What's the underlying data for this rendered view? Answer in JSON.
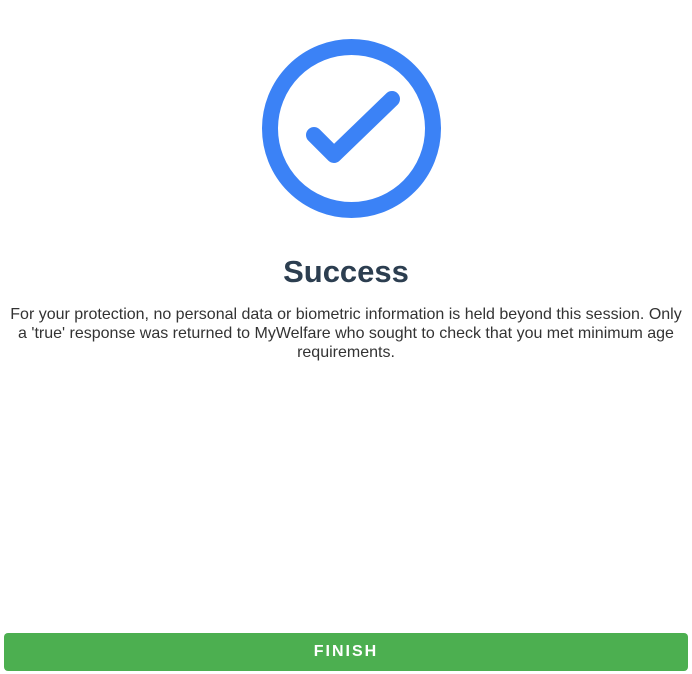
{
  "icon": {
    "name": "check-circle-icon",
    "color": "#3b82f6"
  },
  "title": "Success",
  "message": "For your protection, no personal data or biometric information is held beyond this session. Only a 'true' response was returned to MyWelfare who sought to check that you met minimum age requirements.",
  "actions": {
    "finish_label": "FINISH",
    "finish_color": "#4caf50"
  }
}
